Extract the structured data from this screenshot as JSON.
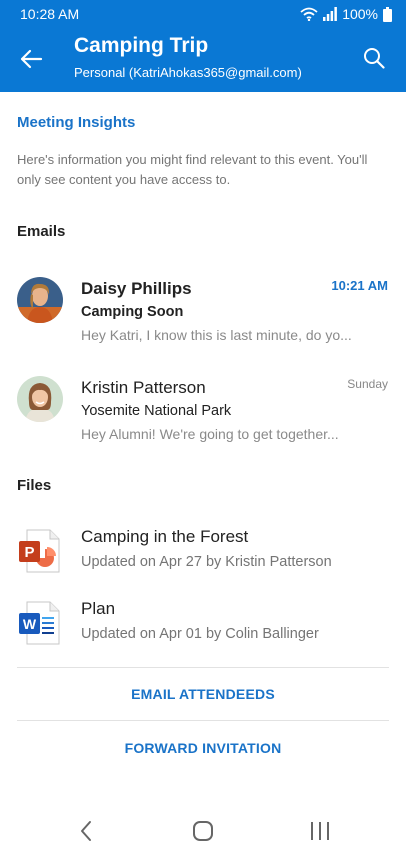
{
  "status_bar": {
    "time": "10:28 AM",
    "battery": "100%",
    "icons": [
      "wifi-icon",
      "signal-icon",
      "battery-icon"
    ]
  },
  "header": {
    "title": "Camping Trip",
    "subtitle": "Personal (KatriAhokas365@gmail.com)",
    "icons": [
      "back-arrow-icon",
      "search-icon"
    ]
  },
  "insights": {
    "title": "Meeting Insights",
    "description": "Here's information you might find relevant to this event. You'll only see content you have access to."
  },
  "emails": {
    "heading": "Emails",
    "items": [
      {
        "sender": "Daisy Phillips",
        "time": "10:21 AM",
        "subject": "Camping Soon",
        "preview": "Hey Katri, I know this is last minute, do yo...",
        "unread": true
      },
      {
        "sender": "Kristin Patterson",
        "time": "Sunday",
        "subject": "Yosemite National Park",
        "preview": "Hey Alumni! We're going to get together...",
        "unread": false
      }
    ]
  },
  "files": {
    "heading": "Files",
    "items": [
      {
        "name": "Camping in the Forest",
        "meta": "Updated on Apr 27 by Kristin Patterson",
        "icon": "powerpoint-file-icon"
      },
      {
        "name": "Plan",
        "meta": "Updated on Apr 01 by Colin Ballinger",
        "icon": "word-file-icon"
      }
    ]
  },
  "actions": {
    "email_attendees": "EMAIL ATTENDEEDS",
    "forward_invitation": "FORWARD INVITATION"
  },
  "colors": {
    "app_bar": "#0a78d4",
    "accent": "#1a73c8",
    "powerpoint": "#c43e1c",
    "word": "#185abd"
  }
}
